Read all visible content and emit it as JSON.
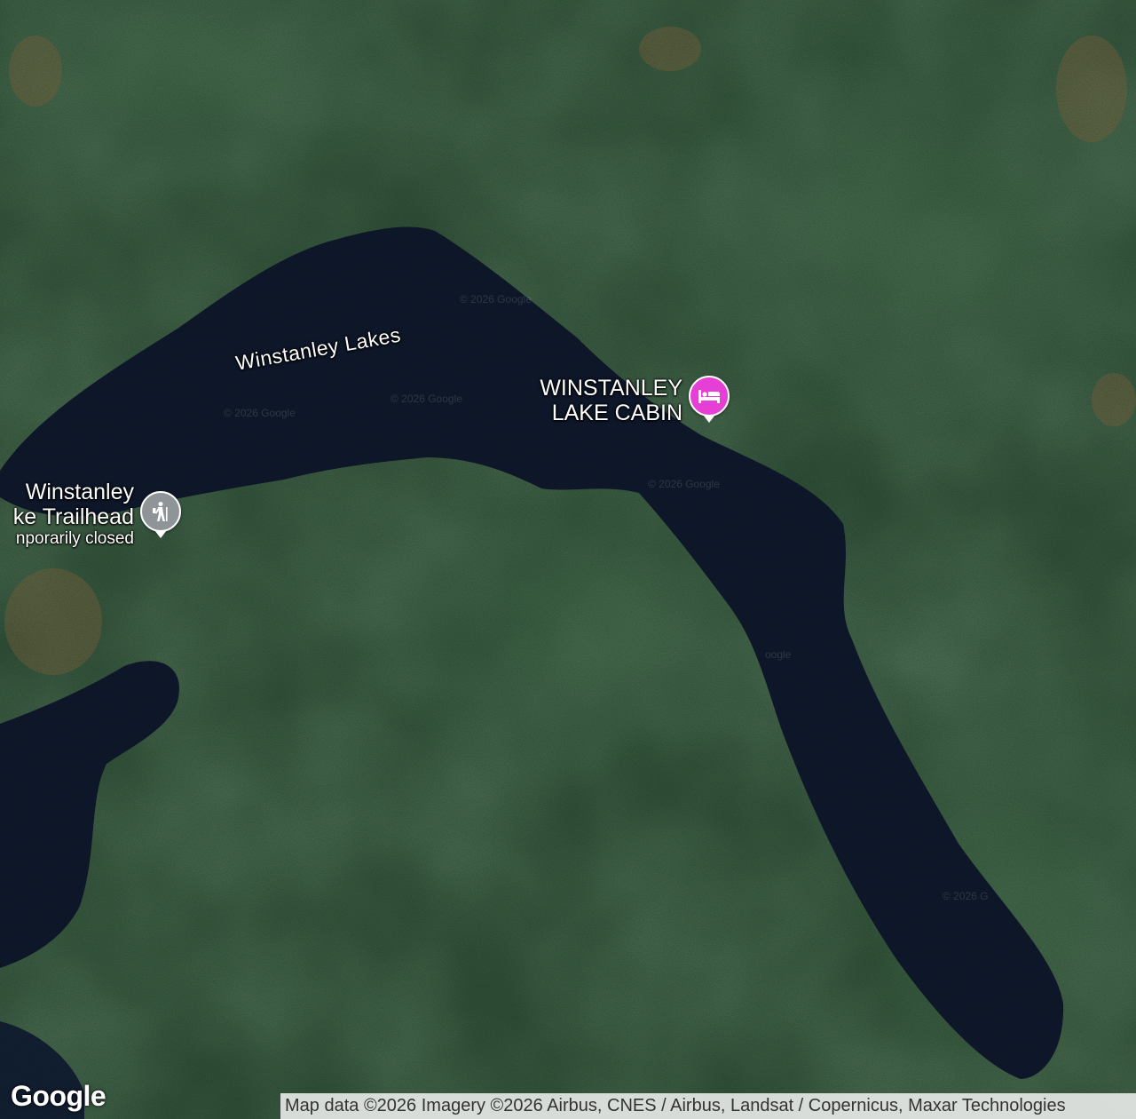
{
  "map": {
    "water_feature": "Winstanley Lakes",
    "cabin": {
      "name_line1": "WINSTANLEY",
      "name_line2": "LAKE CABIN",
      "icon": "bed-icon",
      "pin_color": "#e63fd6"
    },
    "trailhead": {
      "name_line1": "Winstanley",
      "name_line2": "ke Trailhead",
      "status": "nporarily closed",
      "icon": "hiker-icon",
      "pin_color": "#8f9498"
    },
    "watermarks": [
      "© 2026 Google",
      "© 2026 Google",
      "© 2026 Google",
      "© 2026 Google",
      "oogle",
      "© 2026 G"
    ]
  },
  "branding": {
    "logo_text": "Google"
  },
  "attribution": {
    "text": "Map data ©2026 Imagery ©2026 Airbus, CNES / Airbus, Landsat / Copernicus, Maxar Technologies"
  },
  "colors": {
    "water": "#101a30",
    "forest": "#2d4d35",
    "forest_light": "#3d6444"
  }
}
